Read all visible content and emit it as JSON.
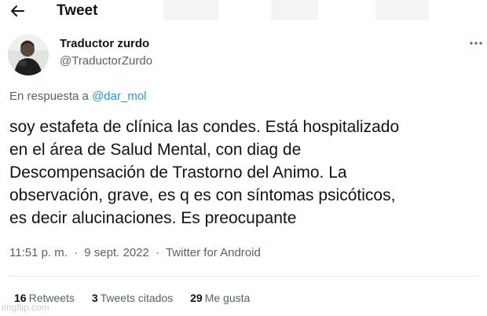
{
  "header": {
    "title": "Tweet",
    "back_icon": "arrow-left-icon"
  },
  "author": {
    "display_name": "Traductor zurdo",
    "handle": "@TraductorZurdo",
    "avatar_icon": "avatar-photo"
  },
  "more_icon": "more-horizontal-icon",
  "reply_to": {
    "prefix": "En respuesta a",
    "handle": "@dar_mol"
  },
  "tweet": {
    "text": "soy estafeta de clínica las condes. Está hospitalizado\nen el área de Salud Mental, con diag de\nDescompensación de Trastorno del Animo. La\nobservación, grave, es q es con síntomas psicóticos,\nes decir alucinaciones. Es preocupante"
  },
  "meta": {
    "time": "11:51 p. m.",
    "separator": "·",
    "date": "9 sept. 2022",
    "source": "Twitter for Android"
  },
  "stats": {
    "retweets_count": "16",
    "retweets_label": "Retweets",
    "quotes_count": "3",
    "quotes_label": "Tweets citados",
    "likes_count": "29",
    "likes_label": "Me gusta"
  },
  "watermark": "imgflip.com",
  "colors": {
    "link": "#1d9bf0",
    "text_primary": "#0f1419",
    "text_secondary": "#536471",
    "divider": "#e8ebed"
  }
}
